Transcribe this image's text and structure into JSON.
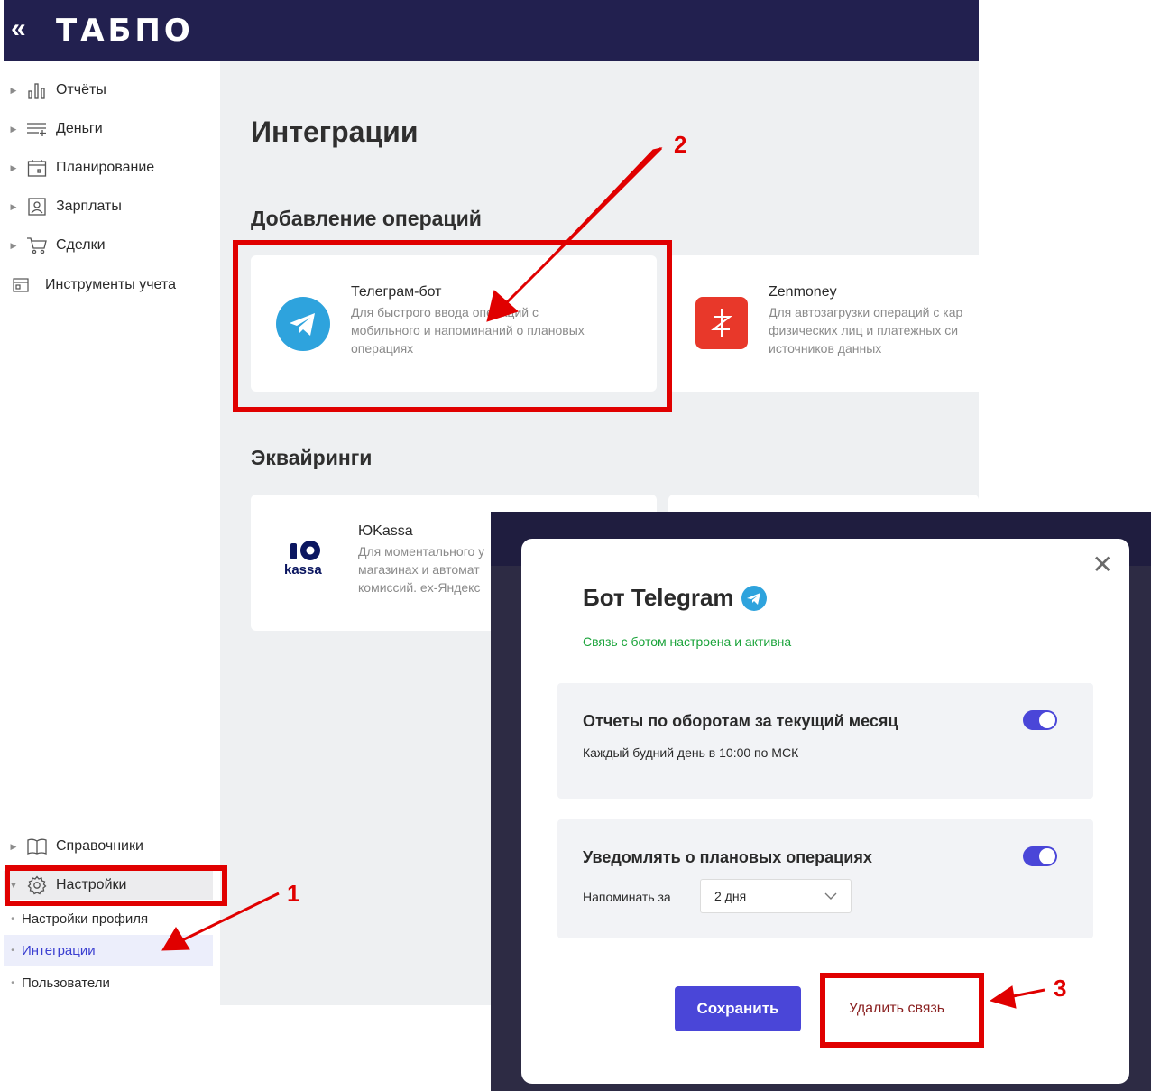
{
  "header": {
    "logo_text": "ТАБПО",
    "collapse_icon": "double-chevron-left-icon"
  },
  "sidebar": {
    "items": [
      {
        "label": "Отчёты",
        "icon": "bar-chart-icon"
      },
      {
        "label": "Деньги",
        "icon": "list-plus-icon"
      },
      {
        "label": "Планирование",
        "icon": "calendar-icon"
      },
      {
        "label": "Зарплаты",
        "icon": "badge-person-icon"
      },
      {
        "label": "Сделки",
        "icon": "cart-icon"
      },
      {
        "label": "Инструменты учета",
        "icon": "tools-card-icon"
      }
    ],
    "bottom_items": [
      {
        "label": "Справочники",
        "icon": "book-icon"
      },
      {
        "label": "Настройки",
        "icon": "gear-icon"
      }
    ],
    "sub_items": [
      {
        "label": "Настройки профиля"
      },
      {
        "label": "Интеграции",
        "active": true
      },
      {
        "label": "Пользователи"
      }
    ]
  },
  "main": {
    "title": "Интеграции",
    "sections": [
      {
        "title": "Добавление операций",
        "cards": [
          {
            "title": "Телеграм-бот",
            "desc_lines": [
              "Для быстрого ввода операций с",
              "мобильного и напоминаний о плановых",
              "операциях"
            ],
            "icon": "telegram-icon"
          },
          {
            "title": "Zenmoney",
            "desc_lines": [
              "Для автозагрузки операций с кар",
              "физических лиц и платежных си",
              "источников данных"
            ],
            "icon": "zenmoney-icon"
          }
        ]
      },
      {
        "title": "Эквайринги",
        "cards": [
          {
            "title": "ЮKassa",
            "desc_lines": [
              "Для моментального у",
              "магазинах и автомат",
              "комиссий. ex-Яндекс"
            ],
            "icon": "yookassa-logo",
            "logo_text": "kassa"
          }
        ]
      }
    ]
  },
  "modal": {
    "title": "Бот Telegram",
    "status": "Связь с ботом настроена и активна",
    "settings": [
      {
        "title": "Отчеты по оборотам за текущий месяц",
        "sub": "Каждый будний день в 10:00 по МСК",
        "enabled": true
      },
      {
        "title": "Уведомлять о плановых операциях",
        "remind_label": "Напоминать за",
        "remind_value": "2 дня",
        "enabled": true
      }
    ],
    "save_label": "Сохранить",
    "delete_label": "Удалить связь"
  },
  "annotations": {
    "labels": [
      "1",
      "2",
      "3"
    ],
    "color": "#e00000"
  },
  "colors": {
    "header": "#22204f",
    "accent": "#4a46d8",
    "success": "#1aa33a",
    "telegram": "#2ea3dd",
    "zenmoney": "#e8382a"
  }
}
